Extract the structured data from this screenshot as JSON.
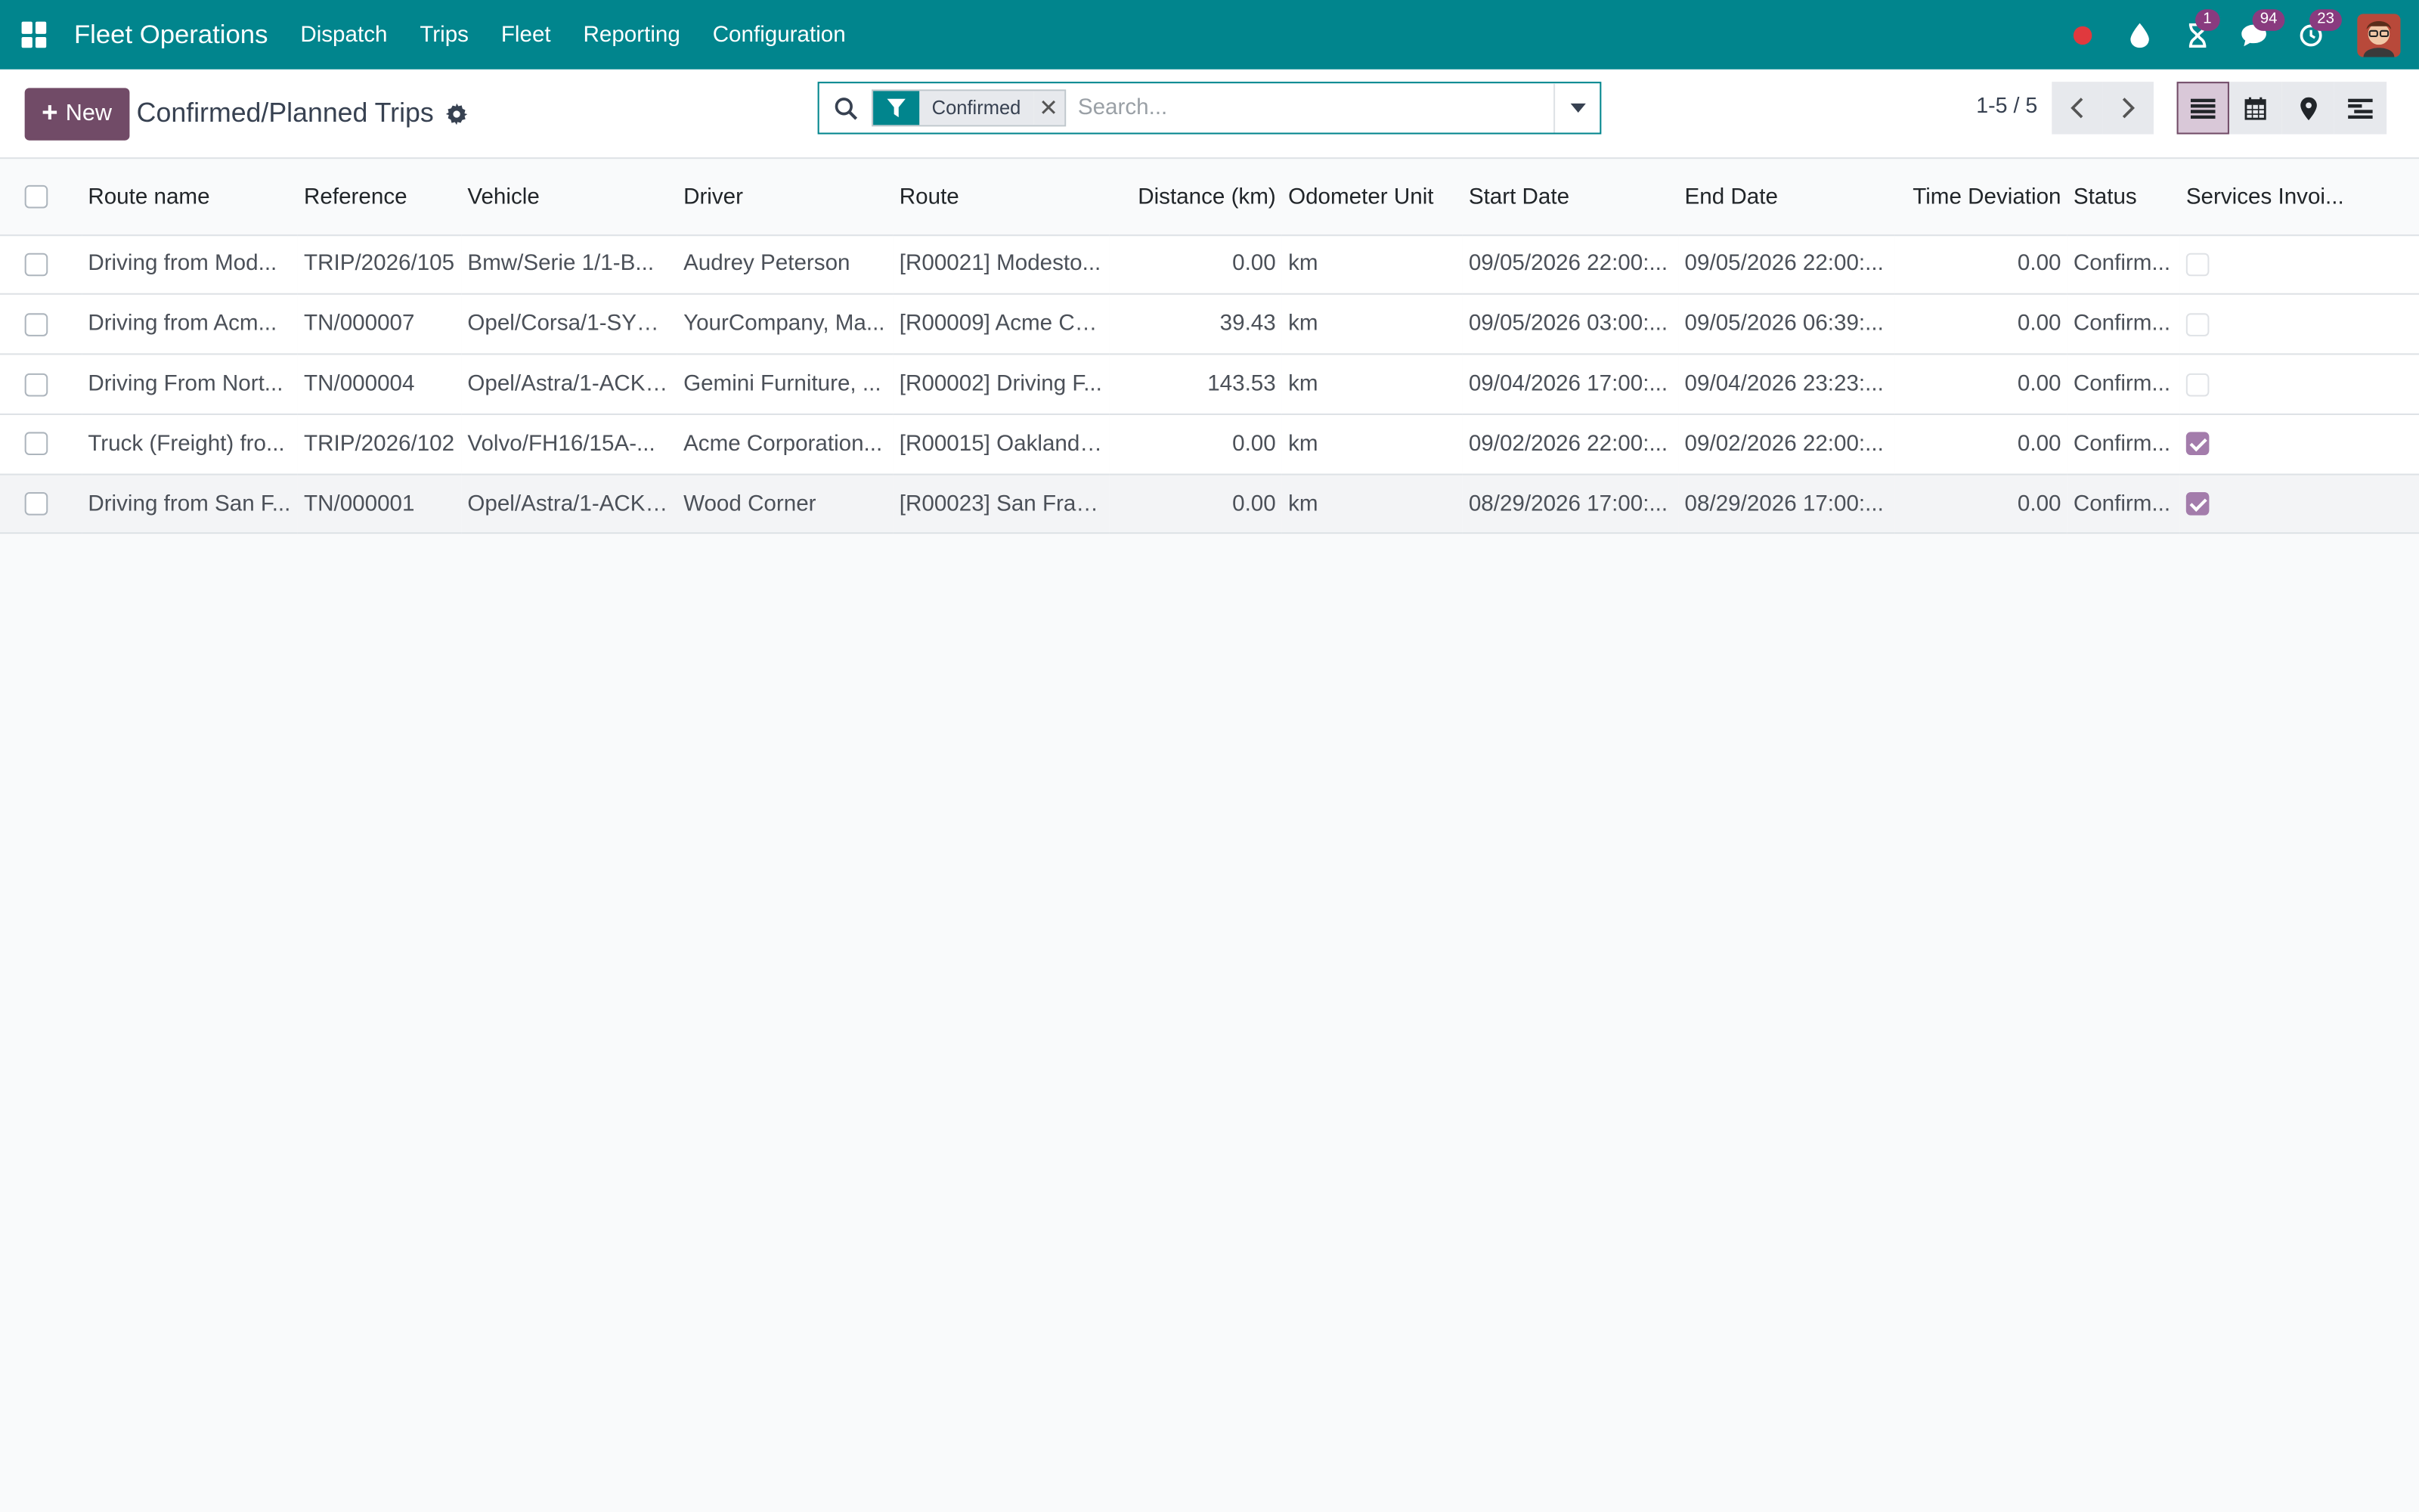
{
  "app": {
    "name": "Fleet Operations",
    "menu": [
      "Dispatch",
      "Trips",
      "Fleet",
      "Reporting",
      "Configuration"
    ],
    "badges": {
      "activities": "1",
      "messages": "94",
      "timers": "23"
    }
  },
  "control": {
    "new_label": "New",
    "title": "Confirmed/Planned Trips",
    "search_placeholder": "Search...",
    "facet": "Confirmed",
    "pager": "1-5 / 5"
  },
  "colors": {
    "navbar": "#01858d",
    "primary": "#714b67",
    "check": "#a37cab"
  },
  "columns": [
    "Route name",
    "Reference",
    "Vehicle",
    "Driver",
    "Route",
    "Distance (km)",
    "Odometer Unit",
    "Start Date",
    "End Date",
    "Time Deviation",
    "Status",
    "Services Invoi..."
  ],
  "rows": [
    {
      "route_name": "Driving from Mod...",
      "reference": "TRIP/2026/105",
      "vehicle": "Bmw/Serie 1/1-B...",
      "driver": "Audrey Peterson",
      "route": "[R00021] Modesto...",
      "distance": "0.00",
      "unit": "km",
      "start": "09/05/2026 22:00:...",
      "end": "09/05/2026 22:00:...",
      "deviation": "0.00",
      "status": "Confirm...",
      "invoiced": false
    },
    {
      "route_name": "Driving from Acm...",
      "reference": "TN/000007",
      "vehicle": "Opel/Corsa/1-SYN...",
      "driver": "YourCompany, Ma...",
      "route": "[R00009] Acme Co...",
      "distance": "39.43",
      "unit": "km",
      "start": "09/05/2026 03:00:...",
      "end": "09/05/2026 06:39:...",
      "deviation": "0.00",
      "status": "Confirm...",
      "invoiced": false
    },
    {
      "route_name": "Driving From Nort...",
      "reference": "TN/000004",
      "vehicle": "Opel/Astra/1-ACK-...",
      "driver": "Gemini Furniture, ...",
      "route": "[R00002] Driving F...",
      "distance": "143.53",
      "unit": "km",
      "start": "09/04/2026 17:00:...",
      "end": "09/04/2026 23:23:...",
      "deviation": "0.00",
      "status": "Confirm...",
      "invoiced": false
    },
    {
      "route_name": "Truck (Freight) fro...",
      "reference": "TRIP/2026/102",
      "vehicle": "Volvo/FH16/15A-...",
      "driver": "Acme Corporation...",
      "route": "[R00015] Oakland ...",
      "distance": "0.00",
      "unit": "km",
      "start": "09/02/2026 22:00:...",
      "end": "09/02/2026 22:00:...",
      "deviation": "0.00",
      "status": "Confirm...",
      "invoiced": true
    },
    {
      "route_name": "Driving from San F...",
      "reference": "TN/000001",
      "vehicle": "Opel/Astra/1-ACK-...",
      "driver": "Wood Corner",
      "route": "[R00023] San Fran...",
      "distance": "0.00",
      "unit": "km",
      "start": "08/29/2026 17:00:...",
      "end": "08/29/2026 17:00:...",
      "deviation": "0.00",
      "status": "Confirm...",
      "invoiced": true
    }
  ]
}
